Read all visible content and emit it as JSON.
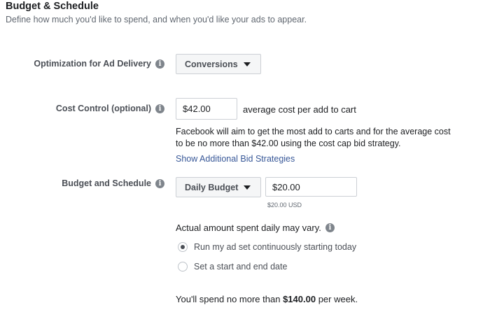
{
  "header": {
    "title": "Budget & Schedule",
    "subtitle": "Define how much you'd like to spend, and when you'd like your ads to appear."
  },
  "optimization": {
    "label": "Optimization for Ad Delivery",
    "value": "Conversions"
  },
  "cost_control": {
    "label": "Cost Control (optional)",
    "value": "$42.00",
    "suffix": "average cost per add to cart",
    "help_line1": "Facebook will aim to get the most add to carts and for the average cost",
    "help_line2": "to be no more than $42.00 using the cost cap bid strategy.",
    "link": "Show Additional Bid Strategies"
  },
  "budget": {
    "label": "Budget and Schedule",
    "type": "Daily Budget",
    "amount": "$20.00",
    "amount_currency": "$20.00 USD",
    "note": "Actual amount spent daily may vary.",
    "options": [
      {
        "label": "Run my ad set continuously starting today",
        "selected": true
      },
      {
        "label": "Set a start and end date",
        "selected": false
      }
    ],
    "summary_prefix": "You'll spend no more than",
    "summary_amount": "$140.00",
    "summary_suffix": "per week."
  },
  "icons": {
    "info": "info-icon",
    "dropdown": "caret-down-icon",
    "radio": "radio-icon"
  },
  "colors": {
    "link": "#385898",
    "label": "#4b4f56",
    "border": "#ccd0d5"
  }
}
